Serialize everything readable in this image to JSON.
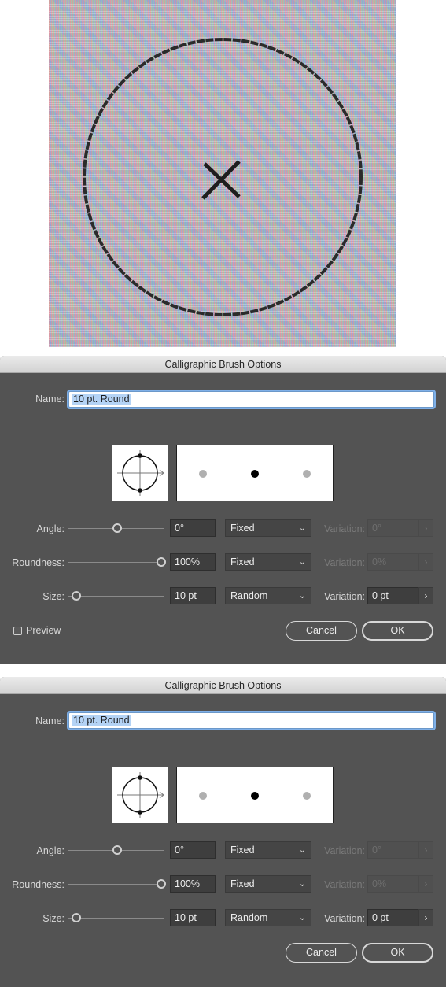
{
  "photo": {
    "cursor_icon": "brush-circle-cursor-with-crosshair"
  },
  "dialogs": [
    {
      "title": "Calligraphic Brush Options",
      "name_label": "Name:",
      "name_value": "10 pt. Round",
      "angle": {
        "label": "Angle:",
        "value": "0°",
        "mode": "Fixed",
        "variation_label": "Variation:",
        "variation_value": "0°",
        "slider_level": 0.5
      },
      "roundness": {
        "label": "Roundness:",
        "value": "100%",
        "mode": "Fixed",
        "variation_label": "Variation:",
        "variation_value": "0%",
        "slider_level": 1.0
      },
      "size": {
        "label": "Size:",
        "value": "10 pt",
        "mode": "Random",
        "variation_label": "Variation:",
        "variation_value": "0 pt",
        "slider_level": 0.0
      },
      "preview_label": "Preview",
      "preview_checked": false,
      "cancel_label": "Cancel",
      "ok_label": "OK"
    },
    {
      "title": "Calligraphic Brush Options",
      "name_label": "Name:",
      "name_value": "10 pt. Round",
      "angle": {
        "label": "Angle:",
        "value": "0°",
        "mode": "Fixed",
        "variation_label": "Variation:",
        "variation_value": "0°",
        "slider_level": 0.5
      },
      "roundness": {
        "label": "Roundness:",
        "value": "100%",
        "mode": "Fixed",
        "variation_label": "Variation:",
        "variation_value": "0%",
        "slider_level": 1.0
      },
      "size": {
        "label": "Size:",
        "value": "10 pt",
        "mode": "Random",
        "variation_label": "Variation:",
        "variation_value": "0 pt",
        "slider_level": 0.0
      },
      "cancel_label": "Cancel",
      "ok_label": "OK"
    }
  ],
  "colors": {
    "dialog_bg": "#535353",
    "titlebar": "#dcdcdc",
    "name_highlight": "#b4d3f5",
    "focus_ring": "#7fb0e8"
  }
}
